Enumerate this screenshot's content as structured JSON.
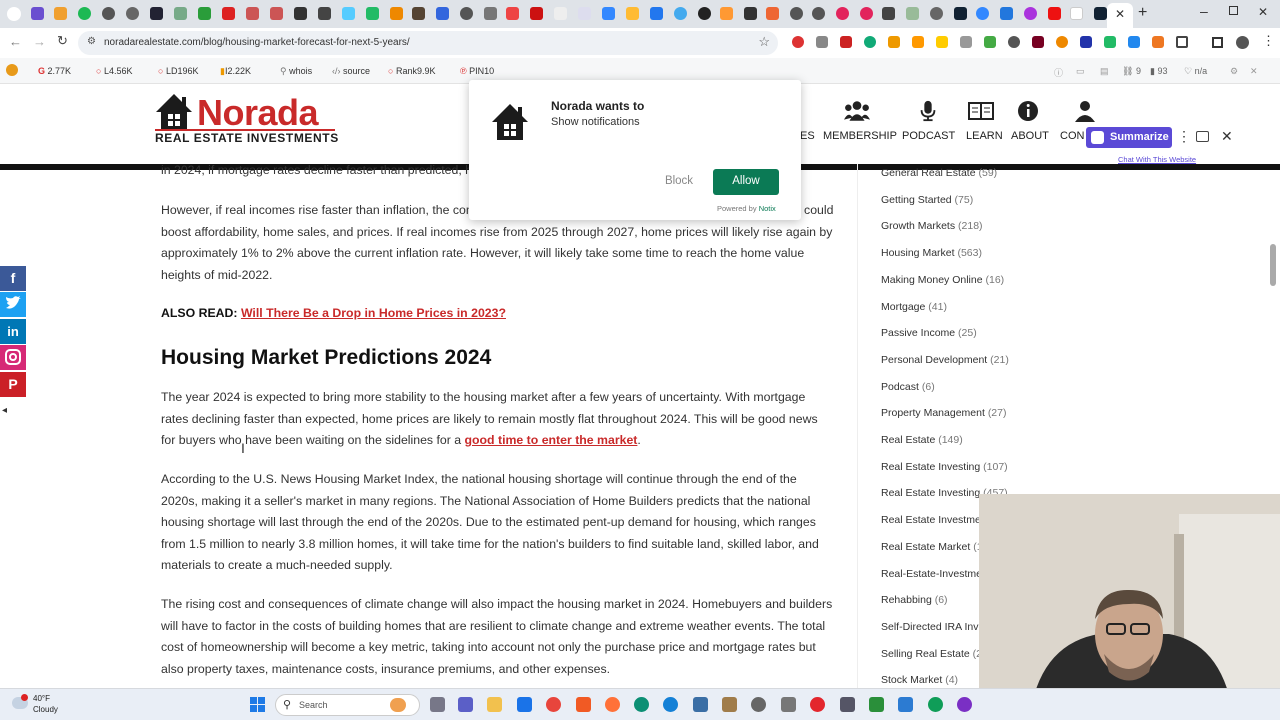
{
  "browser": {
    "url": "noradarealestate.com/blog/housing-market-forecast-for-next-5-years/"
  },
  "extensions": {
    "g": "2.77K",
    "l": "L4.56K",
    "ld": "LD196K",
    "i": "I2.22K",
    "whois": "whois",
    "source": "source",
    "rank": "Rank9.9K",
    "pin": "PIN10",
    "count_a": "9",
    "count_b": "93",
    "na": "n/a"
  },
  "site": {
    "logo_title": "Norada",
    "logo_subtitle": "REAL ESTATE INVESTMENTS",
    "nav": {
      "partial": "ES",
      "membership": "MEMBERSHIP",
      "podcast": "PODCAST",
      "learn": "LEARN",
      "about": "ABOUT",
      "contact_partial": "CON"
    }
  },
  "article": {
    "top_line": "in 2024, if mortgage rates decline faster than predicted, ho",
    "p1": "However, if real incomes rise faster than inflation, the com                                                                                                could boost affordability, home sales, and prices. If real incomes rise from 2025 through 2027, home prices will likely rise again by approximately 1% to 2% above the current inflation rate. However, it will likely take some time to reach the home value heights of mid-2022.",
    "also_read_label": "ALSO READ:",
    "also_read_link": "Will There Be a Drop in Home Prices in 2023?",
    "heading": "Housing Market Predictions 2024",
    "p2": "The year 2024 is expected to bring more stability to the housing market after a few years of uncertainty. With mortgage rates declining faster than expected, home prices are likely to remain mostly flat throughout 2024. This will be good news for buyers who have been waiting on the sidelines for a ",
    "p2_link": "good time to enter the market",
    "p2_end": ".",
    "p3": "According to the U.S. News Housing Market Index, the national housing shortage will continue through the end of the 2020s, making it a seller's market in many regions. The National Association of Home Builders predicts that the national housing shortage will last through the end of the 2020s. Due to the estimated pent-up demand for housing, which ranges from 1.5 million to nearly 3.8 million homes, it will take time for the nation's builders to find suitable land, skilled labor, and materials to create a much-needed supply.",
    "p4": "The rising cost and consequences of climate change will also impact the housing market in 2024. Homebuyers and builders will have to factor in the costs of building homes that are resilient to climate change and extreme weather events. The total cost of homeownership will become a key metric, taking into account not only the purchase price and mortgage rates but also property taxes, maintenance costs, insurance premiums, and other expenses."
  },
  "sidebar": {
    "categories": [
      {
        "name": "General Real Estate",
        "count": "(59)"
      },
      {
        "name": "Getting Started",
        "count": "(75)"
      },
      {
        "name": "Growth Markets",
        "count": "(218)"
      },
      {
        "name": "Housing Market",
        "count": "(563)"
      },
      {
        "name": "Making Money Online",
        "count": "(16)"
      },
      {
        "name": "Mortgage",
        "count": "(41)"
      },
      {
        "name": "Passive Income",
        "count": "(25)"
      },
      {
        "name": "Personal Development",
        "count": "(21)"
      },
      {
        "name": "Podcast",
        "count": "(6)"
      },
      {
        "name": "Property Management",
        "count": "(27)"
      },
      {
        "name": "Real Estate",
        "count": "(149)"
      },
      {
        "name": "Real Estate Investing",
        "count": "(107)"
      },
      {
        "name": "Real Estate Investing",
        "count": "(457)"
      },
      {
        "name": "Real Estate Investmen",
        "count": ""
      },
      {
        "name": "Real Estate Market",
        "count": "(14"
      },
      {
        "name": "Real-Estate-Investmen",
        "count": ""
      },
      {
        "name": "Rehabbing",
        "count": "(6)"
      },
      {
        "name": "Self-Directed IRA Inves",
        "count": ""
      },
      {
        "name": "Selling Real Estate",
        "count": "(29"
      },
      {
        "name": "Stock Market",
        "count": "(4)"
      }
    ]
  },
  "popup": {
    "title": "Norada wants to",
    "message": "Show notifications",
    "block": "Block",
    "allow": "Allow",
    "powered_prefix": "Powered by",
    "powered_brand": "Notix"
  },
  "widget": {
    "summarize": "Summarize",
    "chat_link": "Chat With This Website"
  },
  "taskbar": {
    "temperature": "40°F",
    "weather": "Cloudy",
    "search_placeholder": "Search"
  },
  "colors": {
    "brand_red": "#c92a2a",
    "allow_green": "#0b7a55",
    "summarize_purple": "#5b4ad6"
  }
}
